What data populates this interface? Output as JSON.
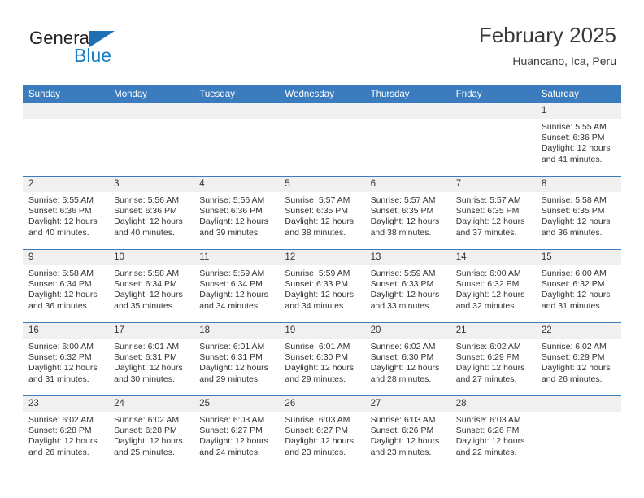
{
  "brand": {
    "name_part1": "General",
    "name_part2": "Blue",
    "triangle_color": "#1f6fb5",
    "blue_color": "#1a7cc4"
  },
  "header": {
    "title": "February 2025",
    "subtitle": "Huancano, Ica, Peru"
  },
  "theme": {
    "header_blue": "#3a7cbe",
    "daynum_bg": "#f0f0f0",
    "text": "#333333"
  },
  "weekday_headers": [
    "Sunday",
    "Monday",
    "Tuesday",
    "Wednesday",
    "Thursday",
    "Friday",
    "Saturday"
  ],
  "labels": {
    "sunrise": "Sunrise:",
    "sunset": "Sunset:",
    "daylight": "Daylight:"
  },
  "weeks": [
    [
      {
        "day": "",
        "sunrise": "",
        "sunset": "",
        "daylight": "",
        "blank": true
      },
      {
        "day": "",
        "sunrise": "",
        "sunset": "",
        "daylight": "",
        "blank": true
      },
      {
        "day": "",
        "sunrise": "",
        "sunset": "",
        "daylight": "",
        "blank": true
      },
      {
        "day": "",
        "sunrise": "",
        "sunset": "",
        "daylight": "",
        "blank": true
      },
      {
        "day": "",
        "sunrise": "",
        "sunset": "",
        "daylight": "",
        "blank": true
      },
      {
        "day": "",
        "sunrise": "",
        "sunset": "",
        "daylight": "",
        "blank": true
      },
      {
        "day": "1",
        "sunrise": "Sunrise: 5:55 AM",
        "sunset": "Sunset: 6:36 PM",
        "daylight": "Daylight: 12 hours and 41 minutes."
      }
    ],
    [
      {
        "day": "2",
        "sunrise": "Sunrise: 5:55 AM",
        "sunset": "Sunset: 6:36 PM",
        "daylight": "Daylight: 12 hours and 40 minutes."
      },
      {
        "day": "3",
        "sunrise": "Sunrise: 5:56 AM",
        "sunset": "Sunset: 6:36 PM",
        "daylight": "Daylight: 12 hours and 40 minutes."
      },
      {
        "day": "4",
        "sunrise": "Sunrise: 5:56 AM",
        "sunset": "Sunset: 6:36 PM",
        "daylight": "Daylight: 12 hours and 39 minutes."
      },
      {
        "day": "5",
        "sunrise": "Sunrise: 5:57 AM",
        "sunset": "Sunset: 6:35 PM",
        "daylight": "Daylight: 12 hours and 38 minutes."
      },
      {
        "day": "6",
        "sunrise": "Sunrise: 5:57 AM",
        "sunset": "Sunset: 6:35 PM",
        "daylight": "Daylight: 12 hours and 38 minutes."
      },
      {
        "day": "7",
        "sunrise": "Sunrise: 5:57 AM",
        "sunset": "Sunset: 6:35 PM",
        "daylight": "Daylight: 12 hours and 37 minutes."
      },
      {
        "day": "8",
        "sunrise": "Sunrise: 5:58 AM",
        "sunset": "Sunset: 6:35 PM",
        "daylight": "Daylight: 12 hours and 36 minutes."
      }
    ],
    [
      {
        "day": "9",
        "sunrise": "Sunrise: 5:58 AM",
        "sunset": "Sunset: 6:34 PM",
        "daylight": "Daylight: 12 hours and 36 minutes."
      },
      {
        "day": "10",
        "sunrise": "Sunrise: 5:58 AM",
        "sunset": "Sunset: 6:34 PM",
        "daylight": "Daylight: 12 hours and 35 minutes."
      },
      {
        "day": "11",
        "sunrise": "Sunrise: 5:59 AM",
        "sunset": "Sunset: 6:34 PM",
        "daylight": "Daylight: 12 hours and 34 minutes."
      },
      {
        "day": "12",
        "sunrise": "Sunrise: 5:59 AM",
        "sunset": "Sunset: 6:33 PM",
        "daylight": "Daylight: 12 hours and 34 minutes."
      },
      {
        "day": "13",
        "sunrise": "Sunrise: 5:59 AM",
        "sunset": "Sunset: 6:33 PM",
        "daylight": "Daylight: 12 hours and 33 minutes."
      },
      {
        "day": "14",
        "sunrise": "Sunrise: 6:00 AM",
        "sunset": "Sunset: 6:32 PM",
        "daylight": "Daylight: 12 hours and 32 minutes."
      },
      {
        "day": "15",
        "sunrise": "Sunrise: 6:00 AM",
        "sunset": "Sunset: 6:32 PM",
        "daylight": "Daylight: 12 hours and 31 minutes."
      }
    ],
    [
      {
        "day": "16",
        "sunrise": "Sunrise: 6:00 AM",
        "sunset": "Sunset: 6:32 PM",
        "daylight": "Daylight: 12 hours and 31 minutes."
      },
      {
        "day": "17",
        "sunrise": "Sunrise: 6:01 AM",
        "sunset": "Sunset: 6:31 PM",
        "daylight": "Daylight: 12 hours and 30 minutes."
      },
      {
        "day": "18",
        "sunrise": "Sunrise: 6:01 AM",
        "sunset": "Sunset: 6:31 PM",
        "daylight": "Daylight: 12 hours and 29 minutes."
      },
      {
        "day": "19",
        "sunrise": "Sunrise: 6:01 AM",
        "sunset": "Sunset: 6:30 PM",
        "daylight": "Daylight: 12 hours and 29 minutes."
      },
      {
        "day": "20",
        "sunrise": "Sunrise: 6:02 AM",
        "sunset": "Sunset: 6:30 PM",
        "daylight": "Daylight: 12 hours and 28 minutes."
      },
      {
        "day": "21",
        "sunrise": "Sunrise: 6:02 AM",
        "sunset": "Sunset: 6:29 PM",
        "daylight": "Daylight: 12 hours and 27 minutes."
      },
      {
        "day": "22",
        "sunrise": "Sunrise: 6:02 AM",
        "sunset": "Sunset: 6:29 PM",
        "daylight": "Daylight: 12 hours and 26 minutes."
      }
    ],
    [
      {
        "day": "23",
        "sunrise": "Sunrise: 6:02 AM",
        "sunset": "Sunset: 6:28 PM",
        "daylight": "Daylight: 12 hours and 26 minutes."
      },
      {
        "day": "24",
        "sunrise": "Sunrise: 6:02 AM",
        "sunset": "Sunset: 6:28 PM",
        "daylight": "Daylight: 12 hours and 25 minutes."
      },
      {
        "day": "25",
        "sunrise": "Sunrise: 6:03 AM",
        "sunset": "Sunset: 6:27 PM",
        "daylight": "Daylight: 12 hours and 24 minutes."
      },
      {
        "day": "26",
        "sunrise": "Sunrise: 6:03 AM",
        "sunset": "Sunset: 6:27 PM",
        "daylight": "Daylight: 12 hours and 23 minutes."
      },
      {
        "day": "27",
        "sunrise": "Sunrise: 6:03 AM",
        "sunset": "Sunset: 6:26 PM",
        "daylight": "Daylight: 12 hours and 23 minutes."
      },
      {
        "day": "28",
        "sunrise": "Sunrise: 6:03 AM",
        "sunset": "Sunset: 6:26 PM",
        "daylight": "Daylight: 12 hours and 22 minutes."
      },
      {
        "day": "",
        "sunrise": "",
        "sunset": "",
        "daylight": "",
        "blank": true
      }
    ]
  ]
}
